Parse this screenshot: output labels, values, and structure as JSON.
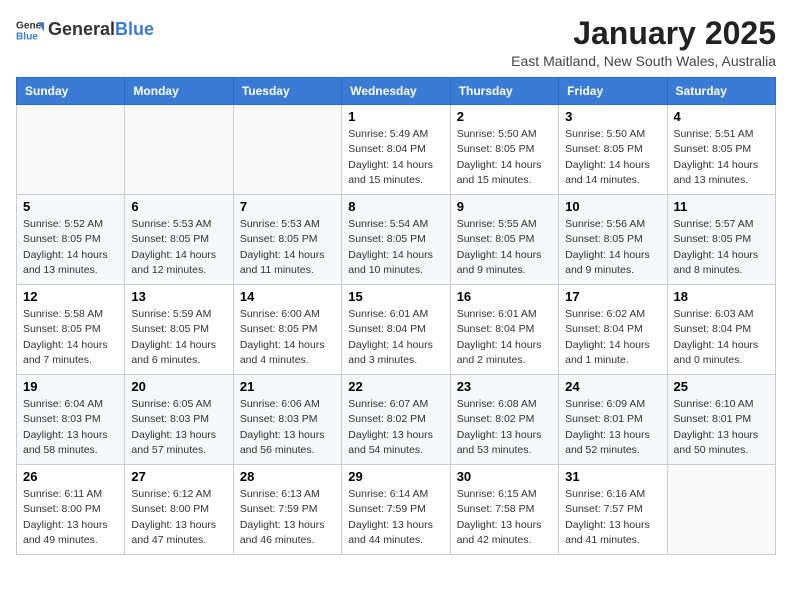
{
  "header": {
    "logo_general": "General",
    "logo_blue": "Blue",
    "month": "January 2025",
    "location": "East Maitland, New South Wales, Australia"
  },
  "days_of_week": [
    "Sunday",
    "Monday",
    "Tuesday",
    "Wednesday",
    "Thursday",
    "Friday",
    "Saturday"
  ],
  "weeks": [
    [
      {
        "day": "",
        "info": ""
      },
      {
        "day": "",
        "info": ""
      },
      {
        "day": "",
        "info": ""
      },
      {
        "day": "1",
        "info": "Sunrise: 5:49 AM\nSunset: 8:04 PM\nDaylight: 14 hours\nand 15 minutes."
      },
      {
        "day": "2",
        "info": "Sunrise: 5:50 AM\nSunset: 8:05 PM\nDaylight: 14 hours\nand 15 minutes."
      },
      {
        "day": "3",
        "info": "Sunrise: 5:50 AM\nSunset: 8:05 PM\nDaylight: 14 hours\nand 14 minutes."
      },
      {
        "day": "4",
        "info": "Sunrise: 5:51 AM\nSunset: 8:05 PM\nDaylight: 14 hours\nand 13 minutes."
      }
    ],
    [
      {
        "day": "5",
        "info": "Sunrise: 5:52 AM\nSunset: 8:05 PM\nDaylight: 14 hours\nand 13 minutes."
      },
      {
        "day": "6",
        "info": "Sunrise: 5:53 AM\nSunset: 8:05 PM\nDaylight: 14 hours\nand 12 minutes."
      },
      {
        "day": "7",
        "info": "Sunrise: 5:53 AM\nSunset: 8:05 PM\nDaylight: 14 hours\nand 11 minutes."
      },
      {
        "day": "8",
        "info": "Sunrise: 5:54 AM\nSunset: 8:05 PM\nDaylight: 14 hours\nand 10 minutes."
      },
      {
        "day": "9",
        "info": "Sunrise: 5:55 AM\nSunset: 8:05 PM\nDaylight: 14 hours\nand 9 minutes."
      },
      {
        "day": "10",
        "info": "Sunrise: 5:56 AM\nSunset: 8:05 PM\nDaylight: 14 hours\nand 9 minutes."
      },
      {
        "day": "11",
        "info": "Sunrise: 5:57 AM\nSunset: 8:05 PM\nDaylight: 14 hours\nand 8 minutes."
      }
    ],
    [
      {
        "day": "12",
        "info": "Sunrise: 5:58 AM\nSunset: 8:05 PM\nDaylight: 14 hours\nand 7 minutes."
      },
      {
        "day": "13",
        "info": "Sunrise: 5:59 AM\nSunset: 8:05 PM\nDaylight: 14 hours\nand 6 minutes."
      },
      {
        "day": "14",
        "info": "Sunrise: 6:00 AM\nSunset: 8:05 PM\nDaylight: 14 hours\nand 4 minutes."
      },
      {
        "day": "15",
        "info": "Sunrise: 6:01 AM\nSunset: 8:04 PM\nDaylight: 14 hours\nand 3 minutes."
      },
      {
        "day": "16",
        "info": "Sunrise: 6:01 AM\nSunset: 8:04 PM\nDaylight: 14 hours\nand 2 minutes."
      },
      {
        "day": "17",
        "info": "Sunrise: 6:02 AM\nSunset: 8:04 PM\nDaylight: 14 hours\nand 1 minute."
      },
      {
        "day": "18",
        "info": "Sunrise: 6:03 AM\nSunset: 8:04 PM\nDaylight: 14 hours\nand 0 minutes."
      }
    ],
    [
      {
        "day": "19",
        "info": "Sunrise: 6:04 AM\nSunset: 8:03 PM\nDaylight: 13 hours\nand 58 minutes."
      },
      {
        "day": "20",
        "info": "Sunrise: 6:05 AM\nSunset: 8:03 PM\nDaylight: 13 hours\nand 57 minutes."
      },
      {
        "day": "21",
        "info": "Sunrise: 6:06 AM\nSunset: 8:03 PM\nDaylight: 13 hours\nand 56 minutes."
      },
      {
        "day": "22",
        "info": "Sunrise: 6:07 AM\nSunset: 8:02 PM\nDaylight: 13 hours\nand 54 minutes."
      },
      {
        "day": "23",
        "info": "Sunrise: 6:08 AM\nSunset: 8:02 PM\nDaylight: 13 hours\nand 53 minutes."
      },
      {
        "day": "24",
        "info": "Sunrise: 6:09 AM\nSunset: 8:01 PM\nDaylight: 13 hours\nand 52 minutes."
      },
      {
        "day": "25",
        "info": "Sunrise: 6:10 AM\nSunset: 8:01 PM\nDaylight: 13 hours\nand 50 minutes."
      }
    ],
    [
      {
        "day": "26",
        "info": "Sunrise: 6:11 AM\nSunset: 8:00 PM\nDaylight: 13 hours\nand 49 minutes."
      },
      {
        "day": "27",
        "info": "Sunrise: 6:12 AM\nSunset: 8:00 PM\nDaylight: 13 hours\nand 47 minutes."
      },
      {
        "day": "28",
        "info": "Sunrise: 6:13 AM\nSunset: 7:59 PM\nDaylight: 13 hours\nand 46 minutes."
      },
      {
        "day": "29",
        "info": "Sunrise: 6:14 AM\nSunset: 7:59 PM\nDaylight: 13 hours\nand 44 minutes."
      },
      {
        "day": "30",
        "info": "Sunrise: 6:15 AM\nSunset: 7:58 PM\nDaylight: 13 hours\nand 42 minutes."
      },
      {
        "day": "31",
        "info": "Sunrise: 6:16 AM\nSunset: 7:57 PM\nDaylight: 13 hours\nand 41 minutes."
      },
      {
        "day": "",
        "info": ""
      }
    ]
  ]
}
